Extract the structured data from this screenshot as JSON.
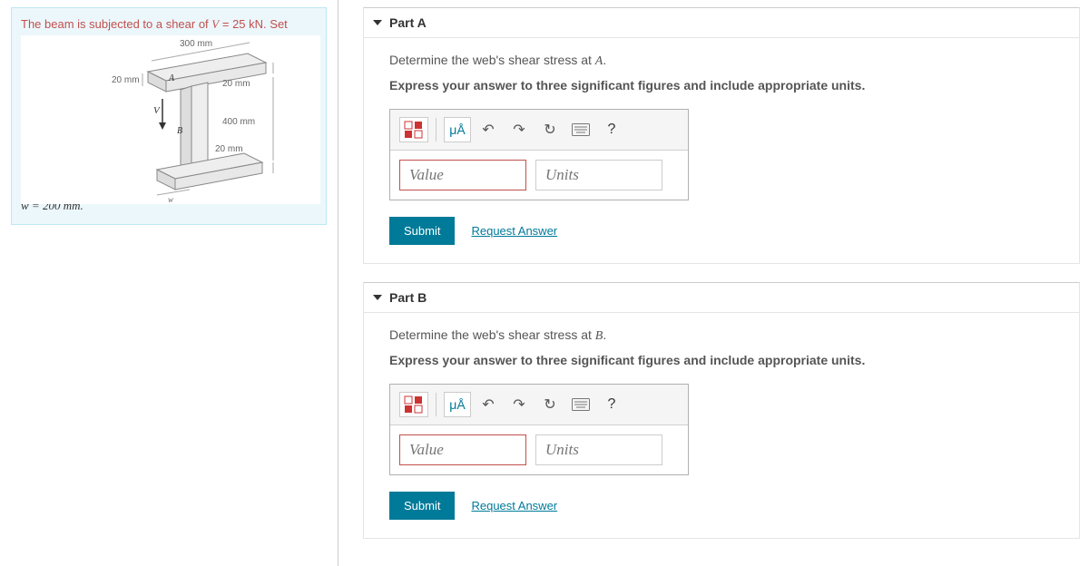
{
  "problem": {
    "prefix": "The beam is subjected to a shear of ",
    "variable": "V",
    "equals": " = ",
    "value": "25 kN",
    "suffix": ". Set",
    "figure": {
      "top_flange_width": "300 mm",
      "left_dim": "20 mm",
      "right_dim_top": "20 mm",
      "right_dim_height": "400 mm",
      "right_dim_bottom": "20 mm",
      "w_label": "w = 200 mm.",
      "point_a": "A",
      "point_b": "B",
      "shear_label": "V",
      "web_label": "w"
    }
  },
  "parts": [
    {
      "title": "Part A",
      "question_prefix": "Determine the web's shear stress at ",
      "question_point": "A",
      "question_suffix": ".",
      "instruction": "Express your answer to three significant figures and include appropriate units.",
      "value_placeholder": "Value",
      "units_placeholder": "Units",
      "submit_label": "Submit",
      "request_label": "Request Answer",
      "toolbar": {
        "units_symbol": "μÅ",
        "help": "?"
      }
    },
    {
      "title": "Part B",
      "question_prefix": "Determine the web's shear stress at ",
      "question_point": "B",
      "question_suffix": ".",
      "instruction": "Express your answer to three significant figures and include appropriate units.",
      "value_placeholder": "Value",
      "units_placeholder": "Units",
      "submit_label": "Submit",
      "request_label": "Request Answer",
      "toolbar": {
        "units_symbol": "μÅ",
        "help": "?"
      }
    }
  ]
}
